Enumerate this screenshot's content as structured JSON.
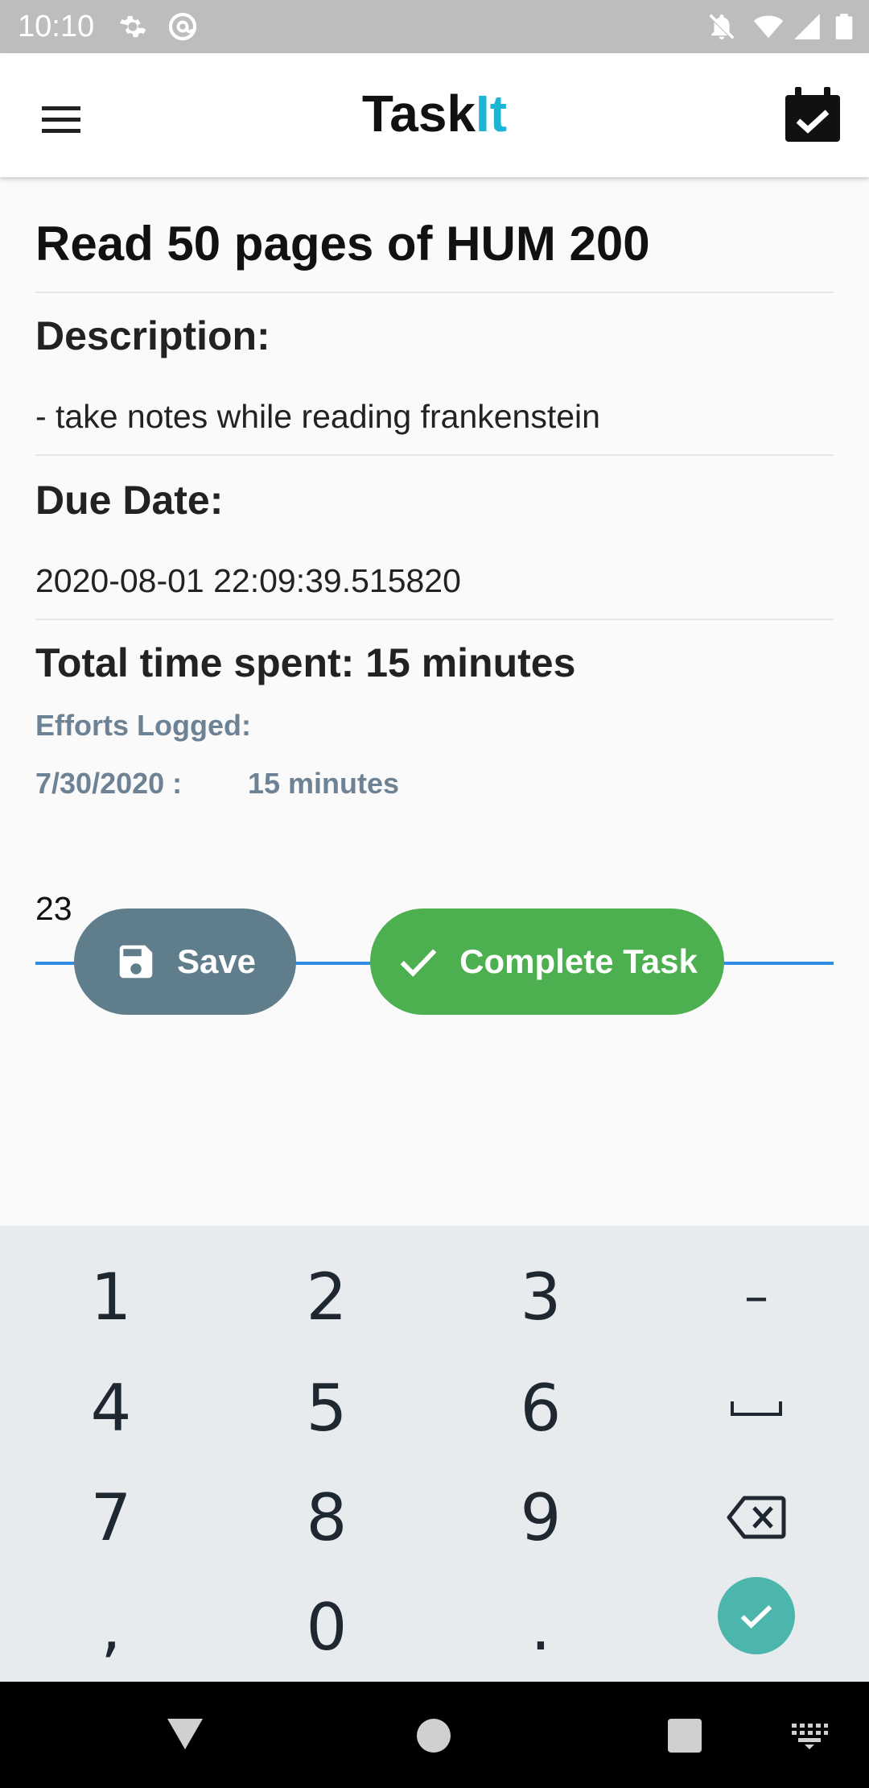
{
  "status_bar": {
    "time": "10:10",
    "left_icons": [
      "gear-icon",
      "at-sign-icon"
    ],
    "right_icons": [
      "do-not-disturb-icon",
      "wifi-icon",
      "signal-icon",
      "battery-icon"
    ]
  },
  "app_bar": {
    "title_prefix": "Task",
    "title_accent": "It",
    "accent_color": "#1cb6d4",
    "menu_icon": "hamburger-menu-icon",
    "calendar_icon": "calendar-check-icon"
  },
  "task": {
    "title": "Read 50 pages of HUM 200",
    "description_label": "Description:",
    "description": "- take notes while reading frankenstein",
    "due_label": "Due Date:",
    "due_date": "2020-08-01 22:09:39.515820",
    "total_time": "Total time spent: 15 minutes",
    "efforts_label": "Efforts Logged:",
    "efforts": [
      {
        "date": "7/30/2020 :",
        "duration": "15 minutes"
      }
    ],
    "effort_input_value": "23"
  },
  "buttons": {
    "save_label": "Save",
    "save_color": "#607d8b",
    "complete_label": "Complete Task",
    "complete_color": "#4caf50"
  },
  "keyboard": {
    "row1": [
      "1",
      "2",
      "3",
      "–"
    ],
    "row2": [
      "4",
      "5",
      "6",
      "space"
    ],
    "row3": [
      "7",
      "8",
      "9",
      "backspace"
    ],
    "row4": [
      ",",
      "0",
      ".",
      "done"
    ]
  },
  "nav_bar": {
    "icons": [
      "back-icon",
      "home-icon",
      "recents-icon",
      "keyboard-switch-icon"
    ]
  }
}
